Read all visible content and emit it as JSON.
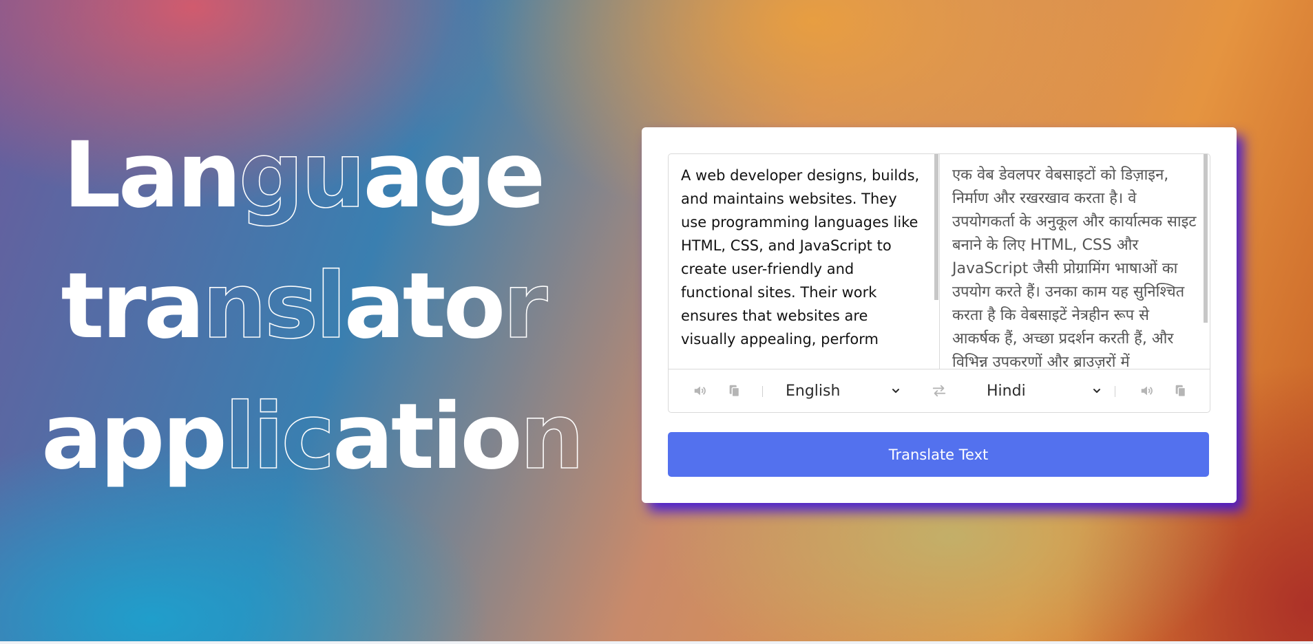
{
  "hero": {
    "line1": {
      "solid_a": "Lan",
      "outline": "gu",
      "solid_b": "age"
    },
    "line2": {
      "solid_a": "tra",
      "outline": "nsl",
      "solid_b": "ato",
      "outline_b": "r"
    },
    "line3": {
      "solid_a": "app",
      "outline": "lic",
      "solid_b": "atio",
      "outline_b": "n"
    }
  },
  "translator": {
    "from_text": "A web developer designs, builds, and maintains websites. They use programming languages like HTML, CSS, and JavaScript to create user-friendly and functional sites. Their work ensures that websites are visually appealing, perform",
    "to_text": "एक वेब डेवलपर वेबसाइटों को डिज़ाइन, निर्माण और रखरखाव करता है। वे उपयोगकर्ता के अनुकूल और कार्यात्मक साइट बनाने के लिए HTML, CSS और JavaScript जैसी प्रोग्रामिंग भाषाओं का उपयोग करते हैं। उनका काम यह सुनिश्चित करता है कि वेबसाइटें नेत्रहीन रूप से आकर्षक हैं, अच्छा प्रदर्शन करती हैं, और विभिन्न उपकरणों और ब्राउज़रों में",
    "from_language": "English",
    "to_language": "Hindi",
    "icons": {
      "speak_from": "volume-icon",
      "copy_from": "copy-icon",
      "swap": "exchange-icon",
      "speak_to": "volume-icon",
      "copy_to": "copy-icon"
    },
    "translate_label": "Translate Text"
  },
  "colors": {
    "button": "#5371ee",
    "card_shadow": "#3c14dc",
    "icon": "#b5b5b5"
  }
}
